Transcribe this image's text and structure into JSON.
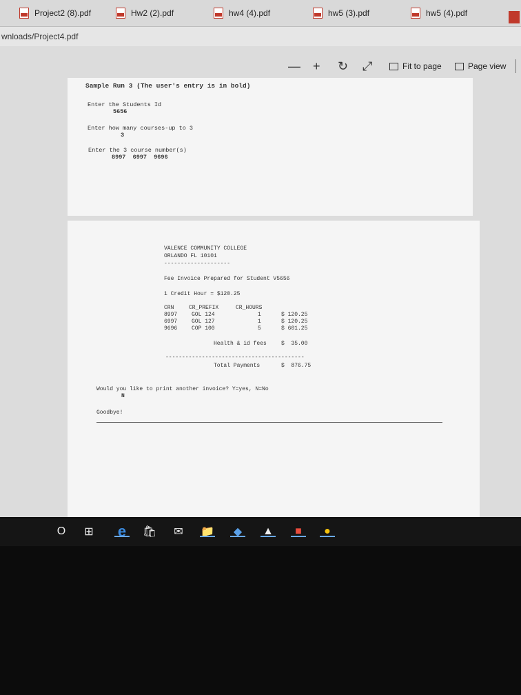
{
  "tabs": [
    {
      "label": "Project2 (8).pdf"
    },
    {
      "label": "Hw2 (2).pdf"
    },
    {
      "label": "hw4 (4).pdf"
    },
    {
      "label": "hw5 (3).pdf"
    },
    {
      "label": "hw5 (4).pdf"
    }
  ],
  "address": "wnloads/Project4.pdf",
  "toolbar": {
    "zoom_out": "—",
    "zoom_in": "+",
    "rotate": "↻",
    "fullscreen": "⤢",
    "fit_to_page": "Fit to page",
    "page_view": "Page view"
  },
  "page1": {
    "heading": "Sample Run 3 (The user's entry is in bold)",
    "prompt1": "Enter the Students Id",
    "entry1": "5656",
    "prompt2": "Enter how many courses-up to 3",
    "entry2": "3",
    "prompt3": "Enter the 3 course number(s)",
    "entry3": "8997  6997  9696"
  },
  "page2": {
    "college": "VALENCE COMMUNITY COLLEGE",
    "city": "ORLANDO FL 10101",
    "dashes": "--------------------",
    "invoice_line": "Fee Invoice Prepared for Student V5656",
    "credit_line": "1 Credit Hour = $120.25",
    "headers": {
      "crn": "CRN",
      "prefix": "CR_PREFIX",
      "hours": "CR_HOURS"
    },
    "rows": [
      {
        "crn": "8997",
        "prefix": "GOL 124",
        "hours": "1",
        "amount": "$ 120.25"
      },
      {
        "crn": "6997",
        "prefix": "GOL 127",
        "hours": "1",
        "amount": "$ 120.25"
      },
      {
        "crn": "9696",
        "prefix": "COP 100",
        "hours": "5",
        "amount": "$ 601.25"
      }
    ],
    "health_label": "Health & id fees",
    "health_amount": "$  35.00",
    "dashes2": "------------------------------------------",
    "total_label": "Total Payments",
    "total_amount": "$  876.75",
    "again_prompt": "Would you like to print another invoice? Y=yes, N=No",
    "again_entry": "N",
    "goodbye": "Goodbye!"
  },
  "taskbar": {
    "start": "O",
    "taskview": "⊞",
    "edge": "e",
    "store": "🛍",
    "mail": "✉",
    "explorer": "📁",
    "photos": "◆",
    "gallery": "▲",
    "apps": "■",
    "chrome": "●"
  }
}
